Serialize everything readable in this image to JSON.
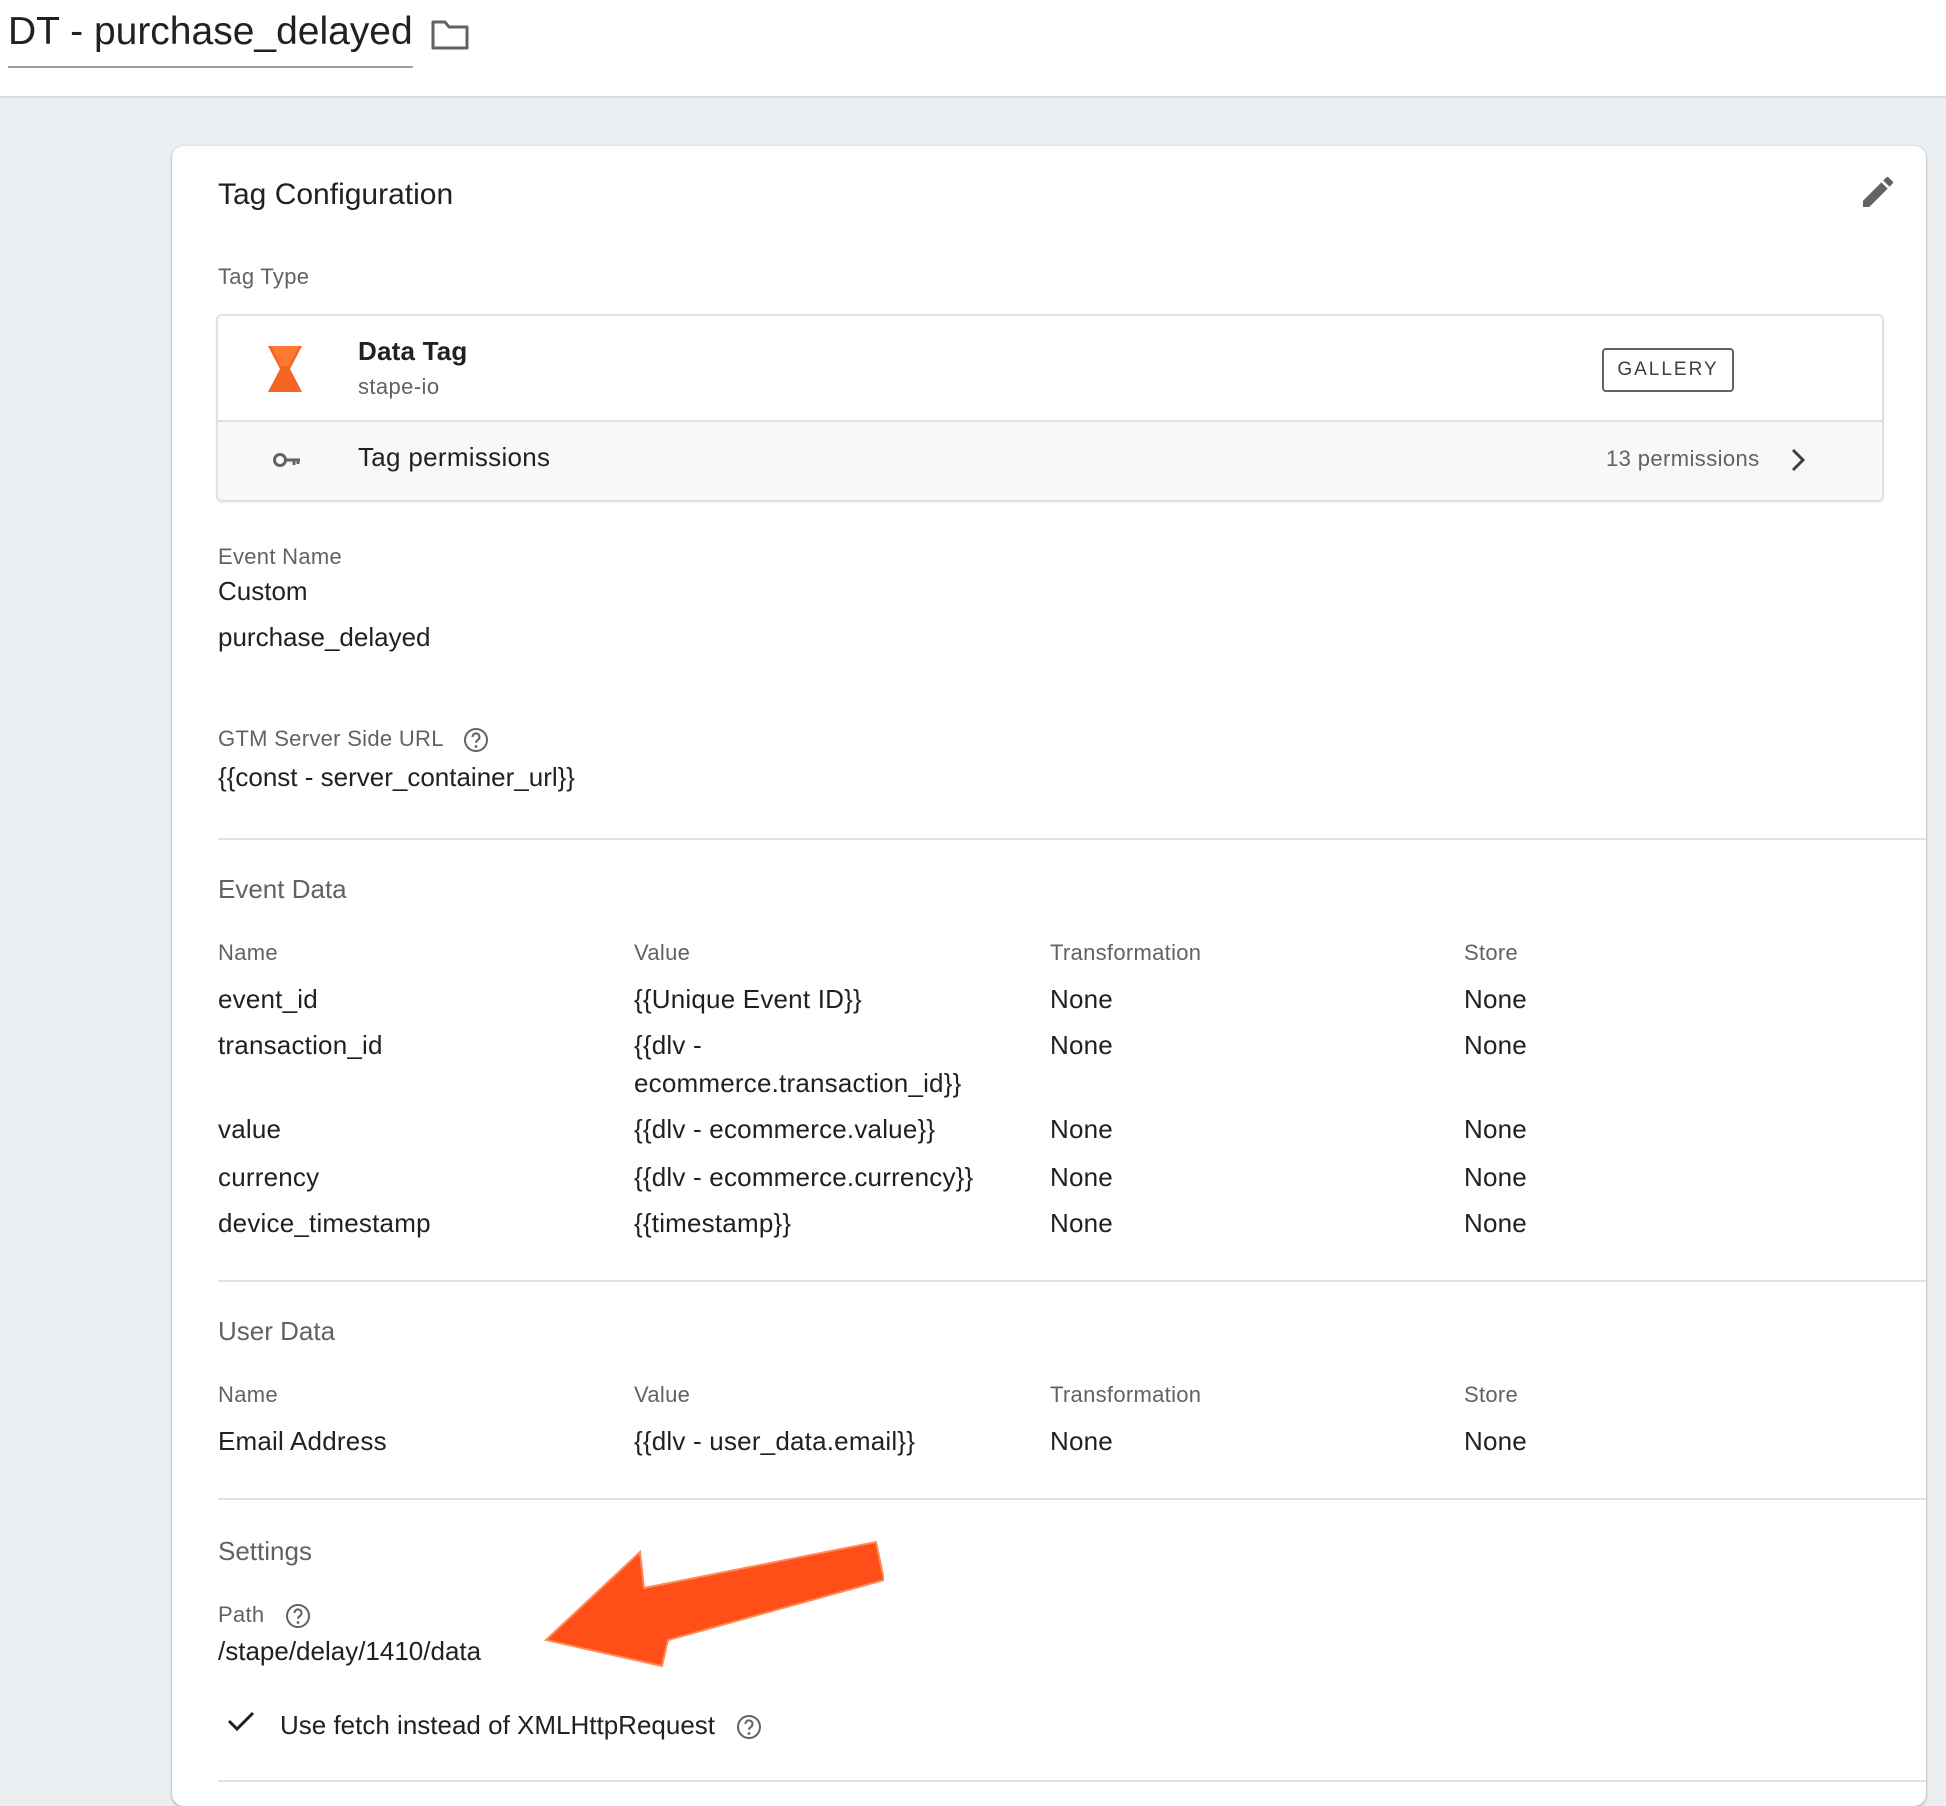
{
  "header": {
    "tag_name": "DT - purchase_delayed"
  },
  "card": {
    "title": "Tag Configuration",
    "tag_type": {
      "label": "Tag Type",
      "name": "Data Tag",
      "vendor": "stape-io",
      "gallery_label": "GALLERY",
      "permissions_label": "Tag permissions",
      "permissions_count": "13 permissions",
      "logo_color": "#f26522"
    },
    "event_name": {
      "label": "Event Name",
      "type": "Custom",
      "value": "purchase_delayed"
    },
    "server_url": {
      "label": "GTM Server Side URL",
      "value": "{{const - server_container_url}}"
    },
    "event_data": {
      "title": "Event Data",
      "headers": [
        "Name",
        "Value",
        "Transformation",
        "Store"
      ],
      "rows": [
        {
          "name": "event_id",
          "value": "{{Unique Event ID}}",
          "value_line2": "",
          "transformation": "None",
          "store": "None"
        },
        {
          "name": "transaction_id",
          "value": "{{dlv -",
          "value_line2": "ecommerce.transaction_id}}",
          "transformation": "None",
          "store": "None"
        },
        {
          "name": "value",
          "value": "{{dlv - ecommerce.value}}",
          "value_line2": "",
          "transformation": "None",
          "store": "None"
        },
        {
          "name": "currency",
          "value": "{{dlv - ecommerce.currency}}",
          "value_line2": "",
          "transformation": "None",
          "store": "None"
        },
        {
          "name": "device_timestamp",
          "value": "{{timestamp}}",
          "value_line2": "",
          "transformation": "None",
          "store": "None"
        }
      ]
    },
    "user_data": {
      "title": "User Data",
      "headers": [
        "Name",
        "Value",
        "Transformation",
        "Store"
      ],
      "rows": [
        {
          "name": "Email Address",
          "value": "{{dlv - user_data.email}}",
          "transformation": "None",
          "store": "None"
        }
      ]
    },
    "settings": {
      "title": "Settings",
      "path_label": "Path",
      "path_value": "/stape/delay/1410/data",
      "fetch_option": "Use fetch instead of XMLHttpRequest"
    }
  },
  "annotation": {
    "arrow_color": "#ff4e17"
  }
}
